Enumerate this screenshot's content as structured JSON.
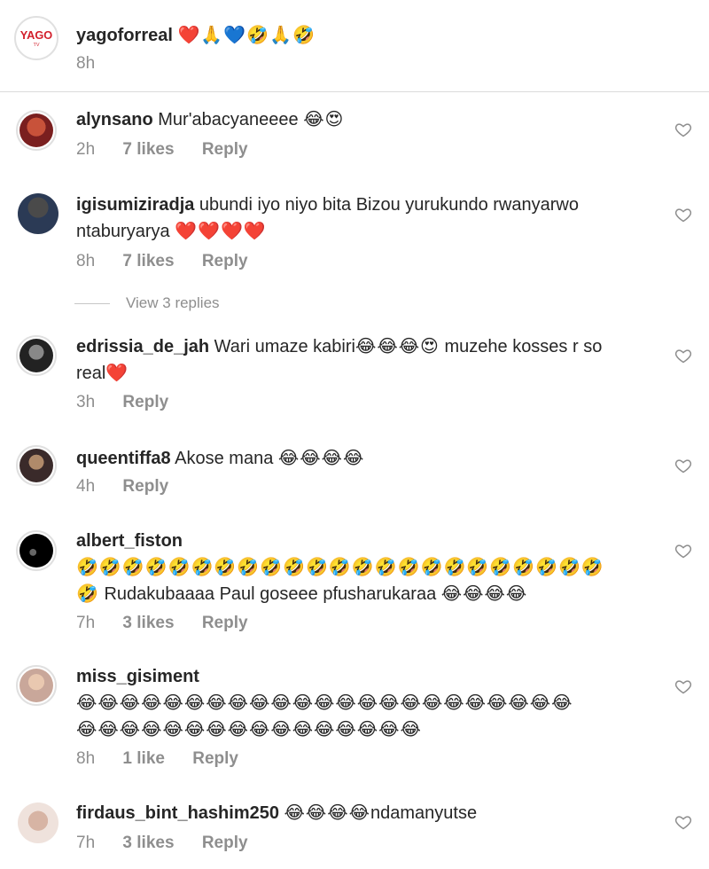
{
  "caption": {
    "username": "yagoforreal",
    "emoji": "❤️🙏💙🤣🙏🤣",
    "time": "8h"
  },
  "comments": [
    {
      "username": "alynsano",
      "text": " Mur'abacyaneeee ",
      "emoji": "😂😍",
      "time": "2h",
      "likes": "7 likes",
      "reply": "Reply"
    },
    {
      "username": "igisumiziradja",
      "text": " ubundi iyo niyo bita Bizou yurukundo rwanyarwo ntaburyarya ",
      "emoji": "❤️❤️❤️❤️",
      "time": "8h",
      "likes": "7 likes",
      "reply": "Reply"
    },
    {
      "username": "edrissia_de_jah",
      "text": " Wari umaze kabiri",
      "emoji": "😂😂😂😍",
      "text2": " muzehe kosses r so real",
      "emoji2": "❤️",
      "time": "3h",
      "reply": "Reply"
    },
    {
      "username": "queentiffa8",
      "text": " Akose mana ",
      "emoji": "😂😂😂😂",
      "time": "4h",
      "reply": "Reply"
    },
    {
      "username": "albert_fiston",
      "emoji": "🤣🤣🤣🤣🤣🤣🤣🤣🤣🤣🤣🤣🤣🤣🤣🤣🤣🤣🤣🤣🤣🤣🤣",
      "emoji_b": "🤣",
      "text": " Rudakubaaaa Paul goseee pfusharukaraa ",
      "emoji2": "😂😂😂😂",
      "time": "7h",
      "likes": "3 likes",
      "reply": "Reply"
    },
    {
      "username": "miss_gisiment",
      "emoji": "😂😂😂😂😂😂😂😂😂😂😂😂😂😂😂😂😂😂😂😂😂😂😂",
      "emoji2": "😂😂😂😂😂😂😂😂😂😂😂😂😂😂😂😂",
      "time": "8h",
      "likes": "1 like",
      "reply": "Reply"
    },
    {
      "username": "firdaus_bint_hashim250",
      "text_pre": " ",
      "emoji": "😂😂😂😂",
      "text": "ndamanyutse",
      "time": "7h",
      "likes": "3 likes",
      "reply": "Reply"
    }
  ],
  "view_replies": "View 3 replies",
  "colors": {
    "heart": "#e0245e",
    "text": "#262626",
    "muted": "#8e8e8e",
    "divider": "#dbdbdb"
  }
}
